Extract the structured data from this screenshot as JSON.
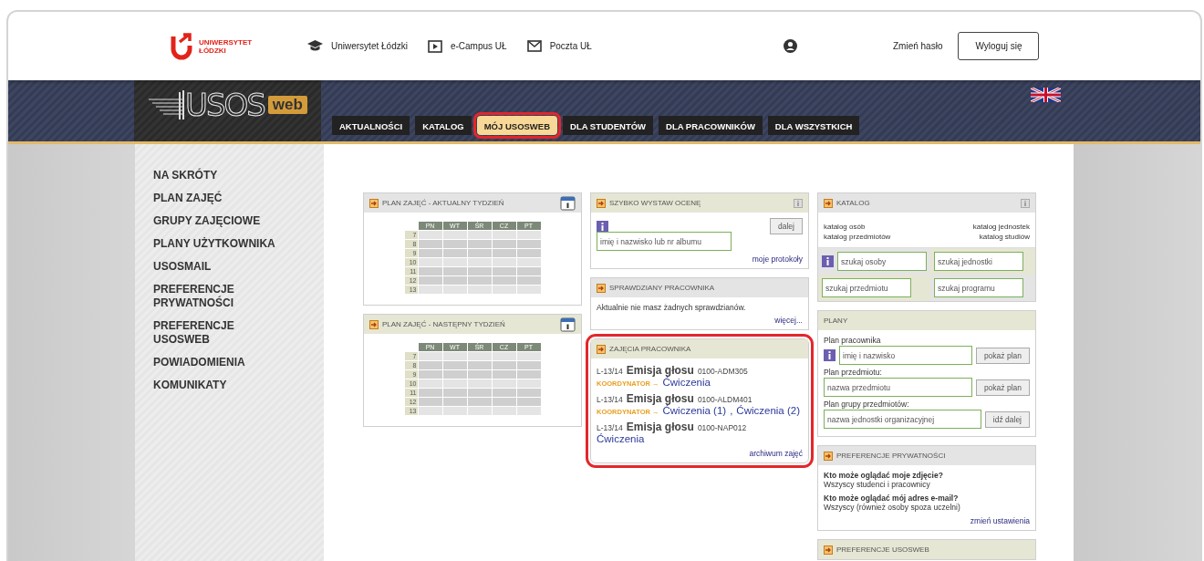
{
  "header": {
    "logo": {
      "line1": "UNIWERSYTET",
      "line2": "ŁÓDZKI"
    },
    "links": [
      {
        "kind": "cap",
        "label": "Uniwersytet Łódzki"
      },
      {
        "kind": "play",
        "label": "e-Campus UŁ"
      },
      {
        "kind": "mail",
        "label": "Poczta UŁ"
      }
    ],
    "change_password": "Zmień hasło",
    "logout": "Wyloguj się"
  },
  "banner": {
    "logo": {
      "main": "USOS",
      "badge": "web"
    },
    "tabs": [
      {
        "label": "AKTUALNOŚCI",
        "selected": false,
        "highlighted": false
      },
      {
        "label": "KATALOG",
        "selected": false,
        "highlighted": false
      },
      {
        "label": "MÓJ USOSWEB",
        "selected": true,
        "highlighted": true
      },
      {
        "label": "DLA STUDENTÓW",
        "selected": false,
        "highlighted": false
      },
      {
        "label": "DLA PRACOWNIKÓW",
        "selected": false,
        "highlighted": false
      },
      {
        "label": "DLA WSZYSTKICH",
        "selected": false,
        "highlighted": false
      }
    ]
  },
  "sidebar": {
    "items": [
      "NA SKRÓTY",
      "PLAN ZAJĘĆ",
      "GRUPY ZAJĘCIOWE",
      "PLANY UŻYTKOWNIKA",
      "USOSMAIL",
      "PREFERENCJE PRYWATNOŚCI",
      "PREFERENCJE USOSWEB",
      "POWIADOMIENIA",
      "KOMUNIKATY"
    ]
  },
  "columns": [
    {
      "panels": [
        {
          "kind": "timetable",
          "title": "PLAN ZAJĘĆ - AKTUALNY TYDZIEŃ",
          "highlighted": false,
          "days": [
            "PN",
            "WT",
            "ŚR",
            "CZ",
            "PT"
          ],
          "hours": [
            "7",
            "8",
            "9",
            "10",
            "11",
            "12",
            "13"
          ]
        },
        {
          "kind": "timetable",
          "title": "PLAN ZAJĘĆ - NASTĘPNY TYDZIEŃ",
          "highlighted": false,
          "days": [
            "PN",
            "WT",
            "ŚR",
            "CZ",
            "PT"
          ],
          "hours": [
            "7",
            "8",
            "9",
            "10",
            "11",
            "12",
            "13"
          ]
        }
      ]
    },
    {
      "panels": [
        {
          "kind": "grade",
          "title": "SZYBKO WYSTAW OCENĘ",
          "highlighted": false,
          "placeholder": "imię i nazwisko lub nr albumu",
          "button": "dalej",
          "link": "moje protokoły"
        },
        {
          "kind": "tests",
          "title": "SPRAWDZIANY PRACOWNIKA",
          "highlighted": false,
          "text": "Aktualnie nie masz żadnych sprawdzianów.",
          "link": "więcej..."
        },
        {
          "kind": "classes",
          "title": "ZAJĘCIA PRACOWNIKA",
          "highlighted": true,
          "link": "archiwum zajęć",
          "entries": [
            {
              "term": "L-13/14",
              "name": "Emisja głosu",
              "code": "0100-ADM305",
              "role": "KOORDYNATOR →",
              "groups": [
                "Ćwiczenia"
              ]
            },
            {
              "term": "L-13/14",
              "name": "Emisja głosu",
              "code": "0100-ALDM401",
              "role": "KOORDYNATOR →",
              "groups": [
                "Ćwiczenia (1)",
                "Ćwiczenia (2)"
              ],
              "separator": ","
            },
            {
              "term": "L-13/14",
              "name": "Emisja głosu",
              "code": "0100-NAP012",
              "groups": [
                "Ćwiczenia"
              ]
            }
          ]
        }
      ]
    },
    {
      "panels": [
        {
          "kind": "catalog",
          "title": "KATALOG",
          "highlighted": false,
          "left_links": [
            "katalog osób",
            "katalog przedmiotów"
          ],
          "right_links": [
            "katalog jednostek",
            "katalog studiów"
          ],
          "searches": [
            {
              "placeholder": "szukaj osoby"
            },
            {
              "placeholder": "szukaj jednostki"
            },
            {
              "placeholder": "szukaj przedmiotu"
            },
            {
              "placeholder": "szukaj programu"
            }
          ]
        },
        {
          "kind": "plans",
          "title": "PLANY",
          "highlighted": false,
          "rows": [
            {
              "label": "Plan pracownika",
              "placeholder": "imię i nazwisko",
              "button": "pokaż plan",
              "info": true
            },
            {
              "label": "Plan przedmiotu:",
              "placeholder": "nazwa przedmiotu",
              "button": "pokaż plan",
              "info": false
            },
            {
              "label": "Plan grupy przedmiotów:",
              "placeholder": "nazwa jednostki organizacyjnej",
              "button": "idź dalej",
              "info": false
            }
          ]
        },
        {
          "kind": "privacy",
          "title": "PREFERENCJE PRYWATNOŚCI",
          "highlighted": false,
          "items": [
            {
              "question": "Kto może oglądać moje zdjęcie?",
              "answer": "Wszyscy studenci i pracownicy"
            },
            {
              "question": "Kto może oglądać mój adres e-mail?",
              "answer": "Wszyscy (również osoby spoza uczelni)"
            }
          ],
          "link": "zmień ustawienia"
        },
        {
          "kind": "prefs",
          "title": "PREFERENCJE USOSWEB",
          "highlighted": false
        }
      ]
    }
  ]
}
